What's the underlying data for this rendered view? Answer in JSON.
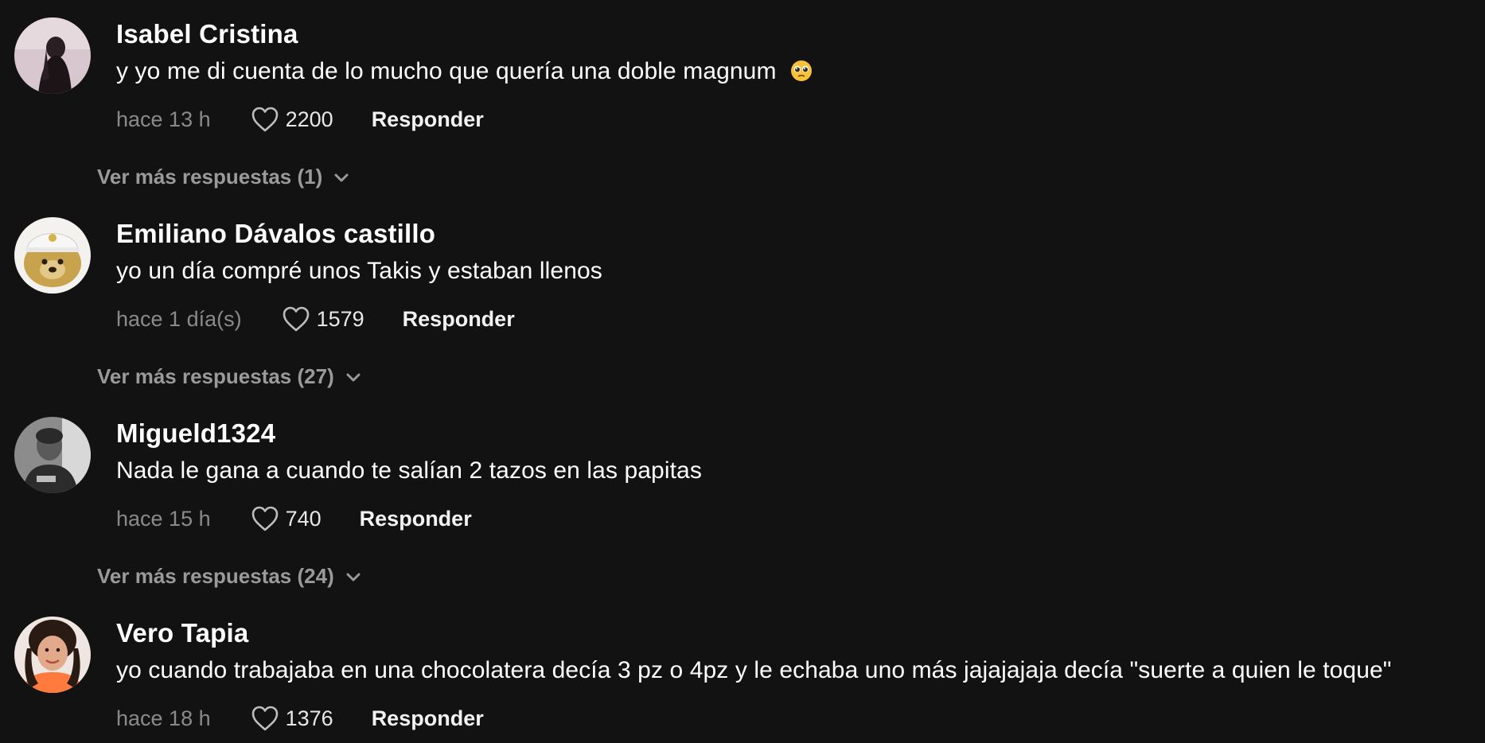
{
  "comments": [
    {
      "username": "Isabel Cristina",
      "text": "y yo me di cuenta de lo mucho que quería una doble magnum",
      "emoji": "pleading-face-emoji",
      "time": "hace 13 h",
      "likes": "2200",
      "reply_label": "Responder",
      "more_replies": "Ver más respuestas (1)"
    },
    {
      "username": "Emiliano Dávalos castillo",
      "text": "yo un día compré unos Takis y estaban llenos",
      "time": "hace 1 día(s)",
      "likes": "1579",
      "reply_label": "Responder",
      "more_replies": "Ver más respuestas (27)"
    },
    {
      "username": "Migueld1324",
      "text": "Nada le gana a cuando te salían 2 tazos en las papitas",
      "time": "hace 15 h",
      "likes": "740",
      "reply_label": "Responder",
      "more_replies": "Ver más respuestas (24)"
    },
    {
      "username": "Vero Tapia",
      "text": "yo cuando trabajaba en una chocolatera decía 3 pz o 4pz y le echaba uno más jajajajaja decía \"suerte a quien le toque\"",
      "time": "hace 18 h",
      "likes": "1376",
      "reply_label": "Responder"
    }
  ],
  "colors": {
    "background": "#121212",
    "username": "#ffffff",
    "meta": "#8a8a8a",
    "more": "#9a9a9a"
  }
}
